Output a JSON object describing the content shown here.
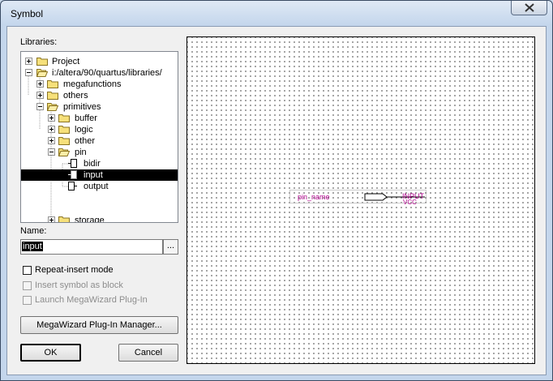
{
  "window": {
    "title": "Symbol"
  },
  "libraries": {
    "label": "Libraries:",
    "tree": [
      {
        "label": "Project"
      },
      {
        "label": "i:/altera/90/quartus/libraries/"
      },
      {
        "label": "megafunctions"
      },
      {
        "label": "others"
      },
      {
        "label": "primitives"
      },
      {
        "label": "buffer"
      },
      {
        "label": "logic"
      },
      {
        "label": "other"
      },
      {
        "label": "pin"
      },
      {
        "label": "bidir"
      },
      {
        "label": "input"
      },
      {
        "label": "output"
      },
      {
        "label": "storage"
      }
    ]
  },
  "name": {
    "label": "Name:",
    "value": "input",
    "browse_label": "..."
  },
  "options": {
    "repeat_insert": "Repeat-insert mode",
    "insert_as_block": "Insert symbol as block",
    "launch_megawizard": "Launch MegaWizard Plug-In"
  },
  "buttons": {
    "megawizard_manager": "MegaWizard Plug-In Manager...",
    "ok": "OK",
    "cancel": "Cancel"
  },
  "preview": {
    "pin_name": "pin_name",
    "pin_type": "INPUT",
    "vcc": "VCC"
  },
  "colors": {
    "symbol_text": "#b0008c",
    "selection": "#000000"
  }
}
